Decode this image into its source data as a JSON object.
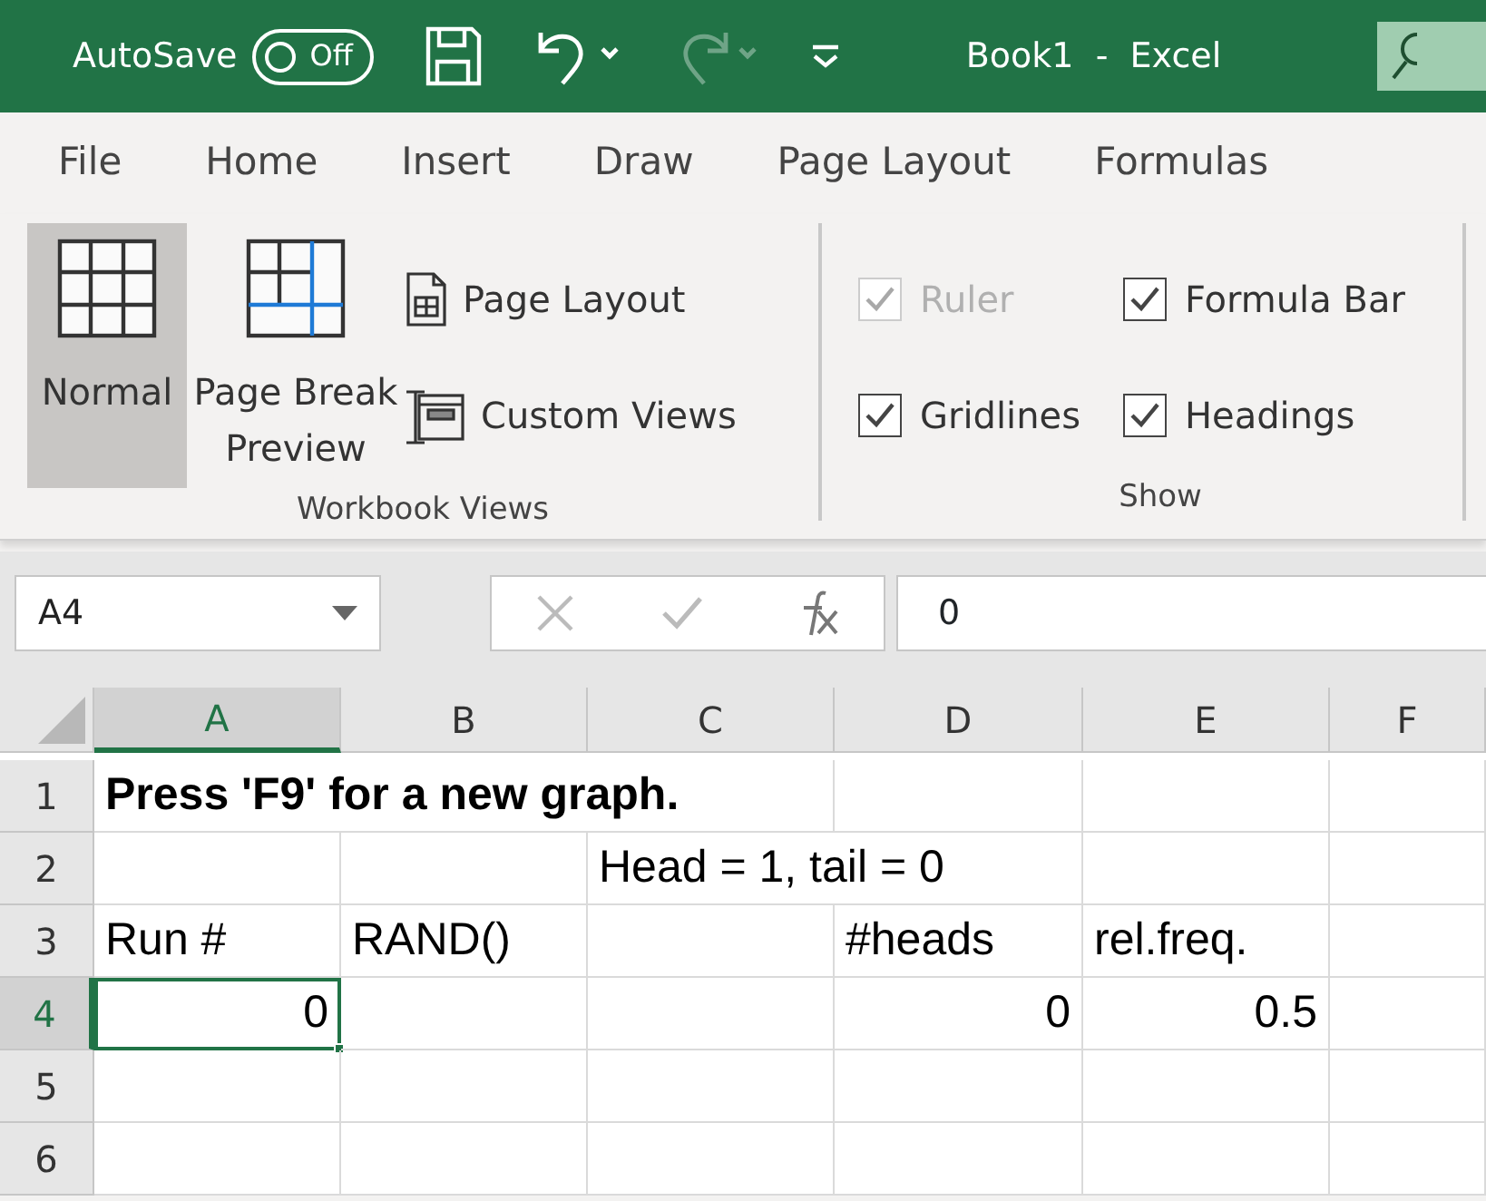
{
  "title_bar": {
    "autosave_label": "AutoSave",
    "autosave": {
      "on": false,
      "label": "Off"
    },
    "undo_enabled": true,
    "redo_enabled": false,
    "title": "Book1  -  Excel"
  },
  "tabs": [
    {
      "label": "File",
      "selected": false
    },
    {
      "label": "Home",
      "selected": false
    },
    {
      "label": "Insert",
      "selected": false
    },
    {
      "label": "Draw",
      "selected": false
    },
    {
      "label": "Page Layout",
      "selected": false
    },
    {
      "label": "Formulas",
      "selected": false
    }
  ],
  "ribbon": {
    "workbook_views": {
      "label": "Workbook Views",
      "large": [
        {
          "label": "Normal",
          "kind": "normal",
          "selected": true
        },
        {
          "label": "Page Break\nPreview",
          "kind": "pagebreak",
          "selected": false
        }
      ],
      "small": [
        {
          "label": "Page Layout",
          "kind": "pagelayout"
        },
        {
          "label": "Custom Views",
          "kind": "custom"
        }
      ]
    },
    "show": {
      "label": "Show",
      "items": [
        {
          "label": "Ruler",
          "checked": true,
          "disabled": true
        },
        {
          "label": "Formula Bar",
          "checked": true,
          "disabled": false
        },
        {
          "label": "Gridlines",
          "checked": true,
          "disabled": false
        },
        {
          "label": "Headings",
          "checked": true,
          "disabled": false
        }
      ]
    }
  },
  "formula_bar": {
    "name_box": "A4",
    "value": "0"
  },
  "sheet": {
    "columns": [
      {
        "label": "A",
        "selected": true
      },
      {
        "label": "B",
        "selected": false
      },
      {
        "label": "C",
        "selected": false
      },
      {
        "label": "D",
        "selected": false
      },
      {
        "label": "E",
        "selected": false
      },
      {
        "label": "F",
        "selected": false
      }
    ],
    "rows": [
      {
        "header": "1",
        "selected": false,
        "cells": [
          {
            "text": "Press 'F9' for a new graph.",
            "kind": "text",
            "bold": true,
            "selected": false
          },
          null,
          null,
          null,
          null,
          null
        ]
      },
      {
        "header": "2",
        "selected": false,
        "cells": [
          null,
          null,
          {
            "text": "Head = 1, tail = 0",
            "kind": "text",
            "bold": false,
            "selected": false
          },
          null,
          null,
          null
        ]
      },
      {
        "header": "3",
        "selected": false,
        "cells": [
          {
            "text": "Run #",
            "kind": "text",
            "bold": false,
            "selected": false
          },
          {
            "text": "RAND()",
            "kind": "text",
            "bold": false,
            "selected": false
          },
          null,
          {
            "text": "#heads",
            "kind": "text",
            "bold": false,
            "selected": false
          },
          {
            "text": "rel.freq.",
            "kind": "text",
            "bold": false,
            "selected": false
          },
          null
        ]
      },
      {
        "header": "4",
        "selected": true,
        "cells": [
          {
            "text": "0",
            "kind": "number",
            "bold": false,
            "selected": true
          },
          null,
          null,
          {
            "text": "0",
            "kind": "number",
            "bold": false,
            "selected": false
          },
          {
            "text": "0.5",
            "kind": "number",
            "bold": false,
            "selected": false
          },
          null
        ]
      },
      {
        "header": "5",
        "selected": false,
        "cells": [
          null,
          null,
          null,
          null,
          null,
          null
        ]
      },
      {
        "header": "6",
        "selected": false,
        "cells": [
          null,
          null,
          null,
          null,
          null,
          null
        ]
      }
    ]
  }
}
